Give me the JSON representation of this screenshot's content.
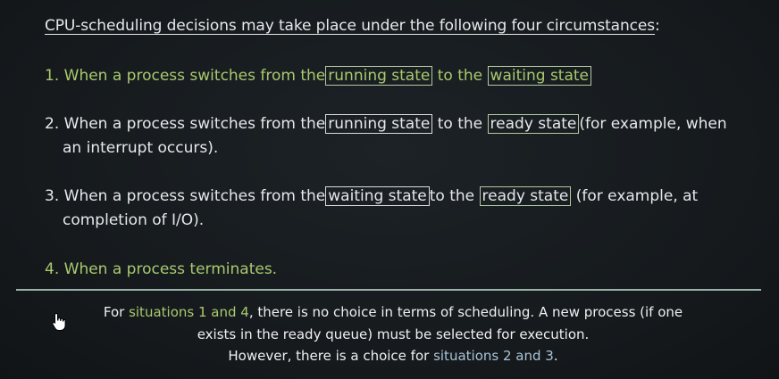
{
  "heading": {
    "underlined": "CPU-scheduling decisions may take place under the following four circumstances",
    "suffix": ":"
  },
  "items": [
    {
      "number": "1.",
      "prefix": "When a process switches from the",
      "from_state": "running state",
      "mid": "to the",
      "to_state": "waiting state",
      "suffix": "",
      "line2": ""
    },
    {
      "number": "2.",
      "prefix": "When a process switches from the",
      "from_state": "running state",
      "mid": "to the",
      "to_state": "ready state",
      "suffix": "(for example, when",
      "line2": "an interrupt occurs)."
    },
    {
      "number": "3.",
      "prefix": "When a process switches from the",
      "from_state": "waiting state",
      "mid": "to the",
      "to_state": "ready state",
      "suffix": "(for example, at",
      "line2": "completion of I/O)."
    },
    {
      "number": "4.",
      "text": "When a process terminates."
    }
  ],
  "footer": {
    "line1_pre": "For",
    "line1_highlight": "situations 1 and 4",
    "line1_post": ", there is no choice in terms of scheduling. A new process (if one",
    "line2": "exists in the ready queue) must be selected for execution.",
    "line3_pre": "However, there is a choice for",
    "line3_highlight": "situations 2 and 3",
    "line3_post": "."
  },
  "colors": {
    "background": "#14181b",
    "text": "#e6e8ea",
    "green_highlight": "#a9c96f",
    "blue_highlight": "#a9c4d8",
    "divider": "#9bb2a8"
  },
  "cursor_icon": "hand-pointer-icon"
}
